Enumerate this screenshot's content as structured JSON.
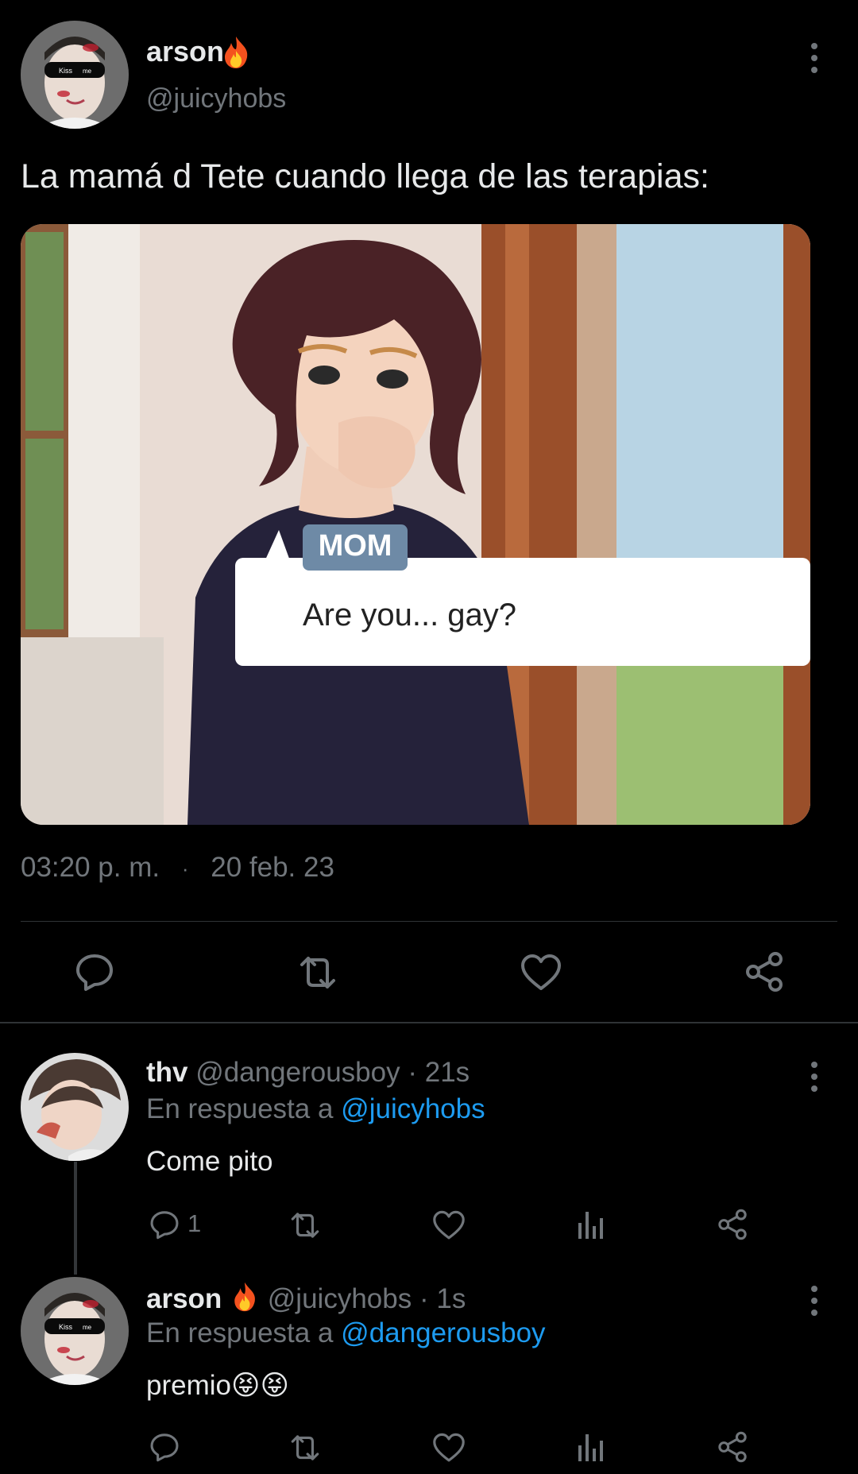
{
  "main_tweet": {
    "display_name": "arson",
    "handle": "@juicyhobs",
    "text": "La mamá d Tete cuando llega de las terapias:",
    "time": "03:20 p. m.",
    "separator": "·",
    "date": "20 feb. 23",
    "avatar": {
      "sunglasses_left": "Kiss",
      "sunglasses_right": "me"
    },
    "image": {
      "speaker_tag": "MOM",
      "dialogue": "Are you... gay?"
    },
    "actions": [
      "reply-icon",
      "retweet-icon",
      "like-icon",
      "share-icon"
    ]
  },
  "replies": [
    {
      "display_name": "thv",
      "handle": "@dangerousboy",
      "separator": "·",
      "time": "21s",
      "replying_prefix": "En respuesta a",
      "replying_to": "@juicyhobs",
      "text": "Come pito",
      "reply_count": "1"
    },
    {
      "display_name": "arson",
      "handle": "@juicyhobs",
      "separator": "·",
      "time": "1s",
      "replying_prefix": "En respuesta a",
      "replying_to": "@dangerousboy",
      "text": "premio",
      "emoji": "😝😝",
      "avatar": {
        "sunglasses_left": "Kiss",
        "sunglasses_right": "me"
      }
    }
  ],
  "colors": {
    "background": "#000000",
    "text": "#e7e9ea",
    "muted": "#71767b",
    "link": "#1d9bf0",
    "divider": "#2f3336"
  }
}
